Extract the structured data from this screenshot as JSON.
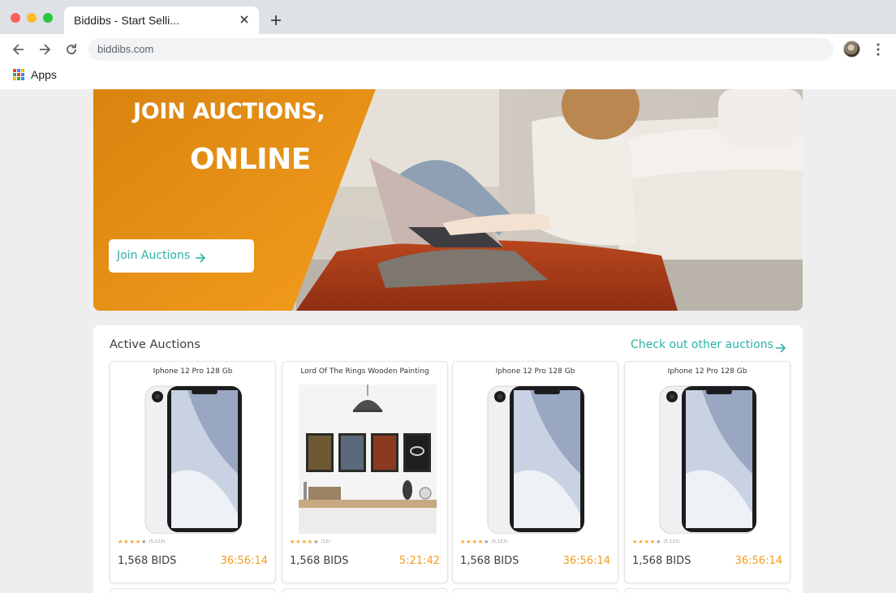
{
  "browser": {
    "tab_title": "Biddibs - Start Selli...",
    "address": "biddibs.com",
    "bookmarks": [
      {
        "label": "Apps"
      }
    ]
  },
  "hero": {
    "line1": "JOIN AUCTIONS,",
    "line2": "ONLINE",
    "button_label": "Join Auctions",
    "accent_color": "#f39c1c"
  },
  "auctions": {
    "title": "Active Auctions",
    "link_label": "Check out other auctions",
    "link_color": "#2ab3a6",
    "items": [
      {
        "name": "Iphone 12 Pro 128 Gb",
        "image": "phone",
        "rating": 4,
        "reviews": "(5,123)",
        "bids": "1,568 BIDS",
        "time_left": "36:56:14"
      },
      {
        "name": "Lord Of The Rings Wooden Painting",
        "image": "painting",
        "rating": 4,
        "reviews": "(12)",
        "bids": "1,568 BIDS",
        "time_left": "5:21:42"
      },
      {
        "name": "Iphone 12 Pro 128 Gb",
        "image": "phone",
        "rating": 4,
        "reviews": "(5,123)",
        "bids": "1,568 BIDS",
        "time_left": "36:56:14"
      },
      {
        "name": "Iphone 12 Pro 128 Gb",
        "image": "phone",
        "rating": 4,
        "reviews": "(5,123)",
        "bids": "1,568 BIDS",
        "time_left": "36:56:14"
      }
    ]
  }
}
